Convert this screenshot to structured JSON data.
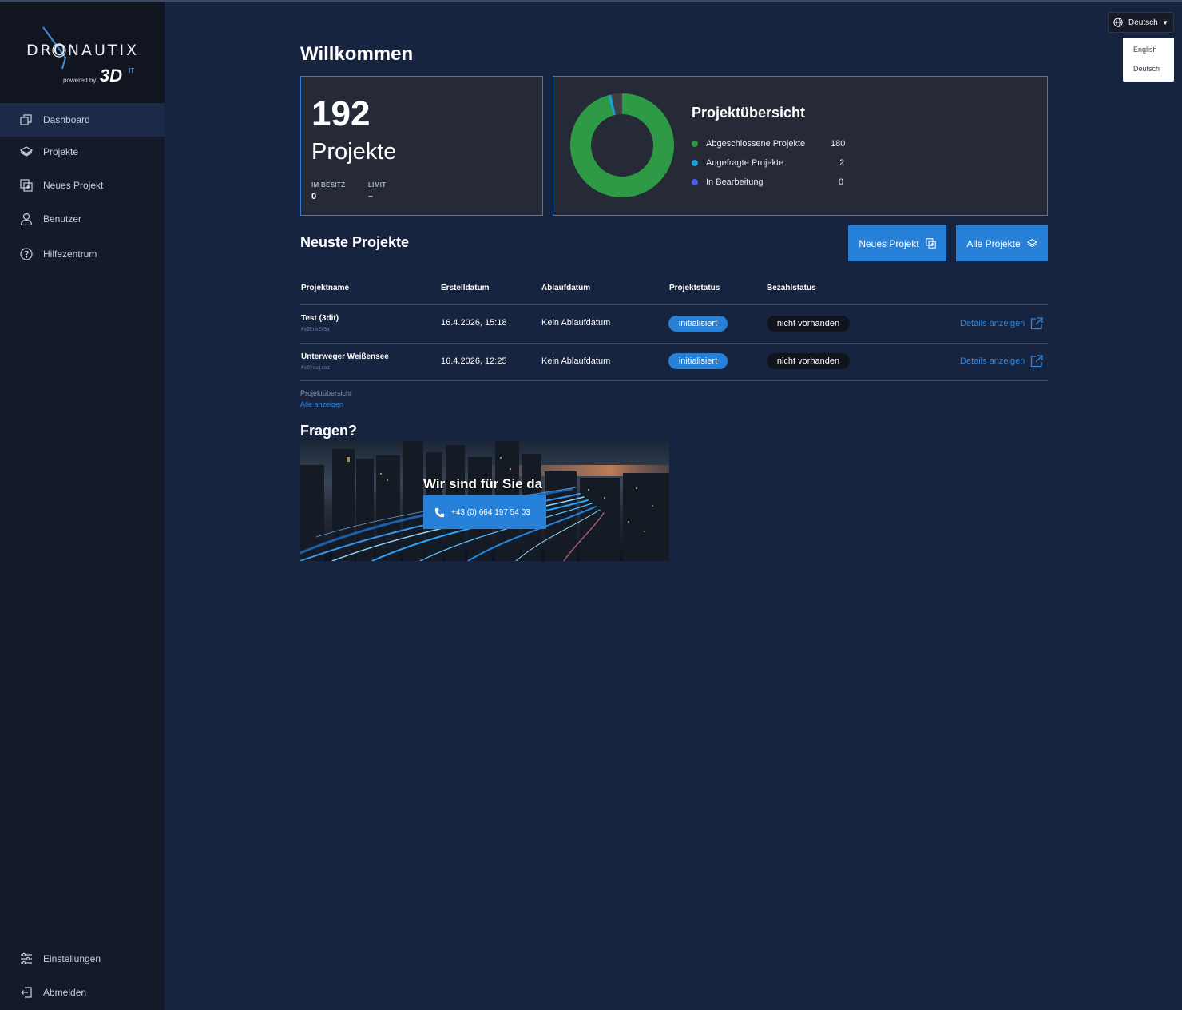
{
  "app": {
    "brand": "DRONAUTIX",
    "powered_by": "powered by",
    "brand_3d": "3D",
    "brand_it": "IT"
  },
  "sidebar": {
    "items": [
      {
        "label": "Dashboard",
        "icon": "dashboard-icon",
        "active": true
      },
      {
        "label": "Projekte",
        "icon": "layers-icon"
      },
      {
        "label": "Neues Projekt",
        "icon": "add-project-icon"
      },
      {
        "label": "Benutzer",
        "icon": "user-icon"
      },
      {
        "label": "Hilfezentrum",
        "icon": "help-icon"
      }
    ],
    "bottom_items": [
      {
        "label": "Einstellungen",
        "icon": "settings-sliders-icon"
      },
      {
        "label": "Abmelden",
        "icon": "logout-icon"
      }
    ]
  },
  "language": {
    "current": "Deutsch",
    "options": [
      "English",
      "Deutsch"
    ]
  },
  "main": {
    "title": "Willkommen",
    "projects_card": {
      "count": "192",
      "label": "Projekte",
      "owned_label": "IM BESITZ",
      "owned_value": "0",
      "limit_label": "LIMIT",
      "limit_value": "–"
    },
    "overview": {
      "title": "Projektübersicht",
      "rows": [
        {
          "label": "Abgeschlossene Projekte",
          "value": "180",
          "color": "#2e9a45"
        },
        {
          "label": "Angefragte Projekte",
          "value": "2",
          "color": "#1aa0d8"
        },
        {
          "label": "In Bearbeitung",
          "value": "0",
          "color": "#4a5ee8"
        }
      ]
    },
    "latest": {
      "title": "Neuste Projekte",
      "new_button": "Neues Projekt",
      "all_button": "Alle Projekte",
      "columns": [
        "Projektname",
        "Erstelldatum",
        "Ablaufdatum",
        "Projektstatus",
        "Bezahlstatus"
      ],
      "rows": [
        {
          "name": "Test (3dit)",
          "id": "PxZEnhEXSx",
          "created": "16.4.2026, 15:18",
          "expiry": "Kein Ablaufdatum",
          "status": "initialisiert",
          "payment": "nicht vorhanden",
          "details": "Details anzeigen"
        },
        {
          "name": "Unterweger Weißensee",
          "id": "PxDYcujcoz",
          "created": "16.4.2026, 12:25",
          "expiry": "Kein Ablaufdatum",
          "status": "initialisiert",
          "payment": "nicht vorhanden",
          "details": "Details anzeigen"
        }
      ],
      "footer_label": "Projektübersicht",
      "footer_link": "Alle anzeigen"
    },
    "help": {
      "title": "Fragen?",
      "banner_title": "Wir sind für Sie da",
      "phone": "+43 (0) 664 197 54 03"
    }
  },
  "chart_data": {
    "type": "pie",
    "categories": [
      "Abgeschlossene Projekte",
      "Angefragte Projekte",
      "In Bearbeitung"
    ],
    "values": [
      180,
      2,
      0
    ]
  },
  "colors": {
    "accent": "#2781d8",
    "background": "#172440",
    "sidebar": "#141a2a",
    "card": "#252a36"
  }
}
